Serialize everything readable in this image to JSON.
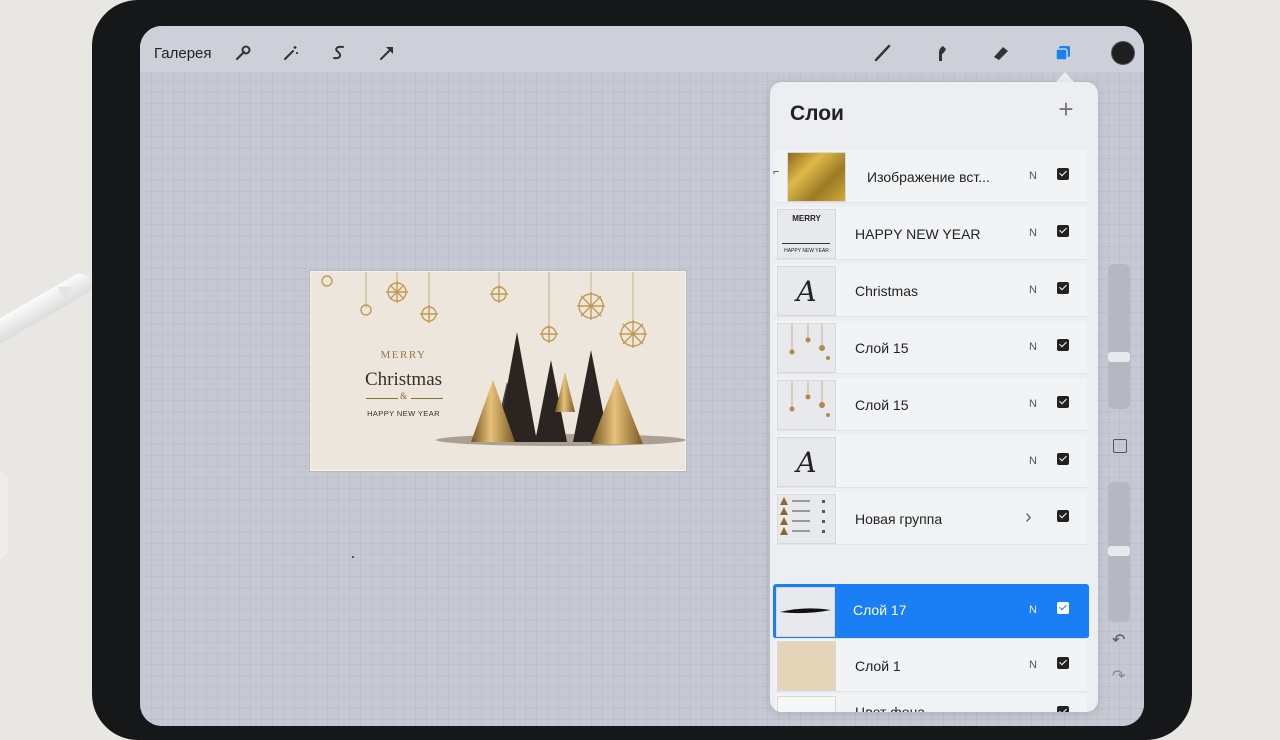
{
  "toolbar": {
    "gallery_label": "Галерея",
    "left_tools": [
      "wrench-icon",
      "magic-wand-icon",
      "selection-icon",
      "transform-arrow-icon"
    ],
    "right_tools": [
      "brush-icon",
      "smudge-icon",
      "eraser-icon",
      "layers-icon",
      "color-swatch"
    ],
    "color_swatch": "#1f1f1f",
    "layers_active_color": "#1a7ef5"
  },
  "artwork": {
    "merry": "MERRY",
    "christmas": "Christmas",
    "amp": "&",
    "happy": "HAPPY NEW YEAR"
  },
  "layers_panel": {
    "title": "Слои",
    "add_icon": "plus-icon",
    "selected_color": "#1a7ef5",
    "layers": [
      {
        "name": "Изображение вст...",
        "blend": "N",
        "visible": true,
        "thumb": "gold-texture",
        "clipped": true
      },
      {
        "name": "HAPPY NEW YEAR",
        "blend": "N",
        "visible": true,
        "thumb": "text-preview"
      },
      {
        "name": "Christmas",
        "blend": "N",
        "visible": true,
        "thumb": "text-glyph"
      },
      {
        "name": "Слой 15",
        "blend": "N",
        "visible": true,
        "thumb": "ornaments"
      },
      {
        "name": "Слой 15",
        "blend": "N",
        "visible": true,
        "thumb": "ornaments"
      },
      {
        "name": "",
        "blend": "N",
        "visible": true,
        "thumb": "text-glyph"
      },
      {
        "name": "Новая группа",
        "blend": "",
        "visible": true,
        "thumb": "group",
        "group": true
      },
      {
        "name": "Слой 17",
        "blend": "N",
        "visible": true,
        "thumb": "stroke",
        "selected": true
      },
      {
        "name": "Слой 1",
        "blend": "N",
        "visible": true,
        "thumb": "beige"
      },
      {
        "name": "Цвет фона",
        "blend": "",
        "visible": true,
        "thumb": "white"
      }
    ]
  },
  "thumb_texts": {
    "merry": "MERRY",
    "happy": "HAPPY NEW YEAR",
    "glyph": "A"
  }
}
